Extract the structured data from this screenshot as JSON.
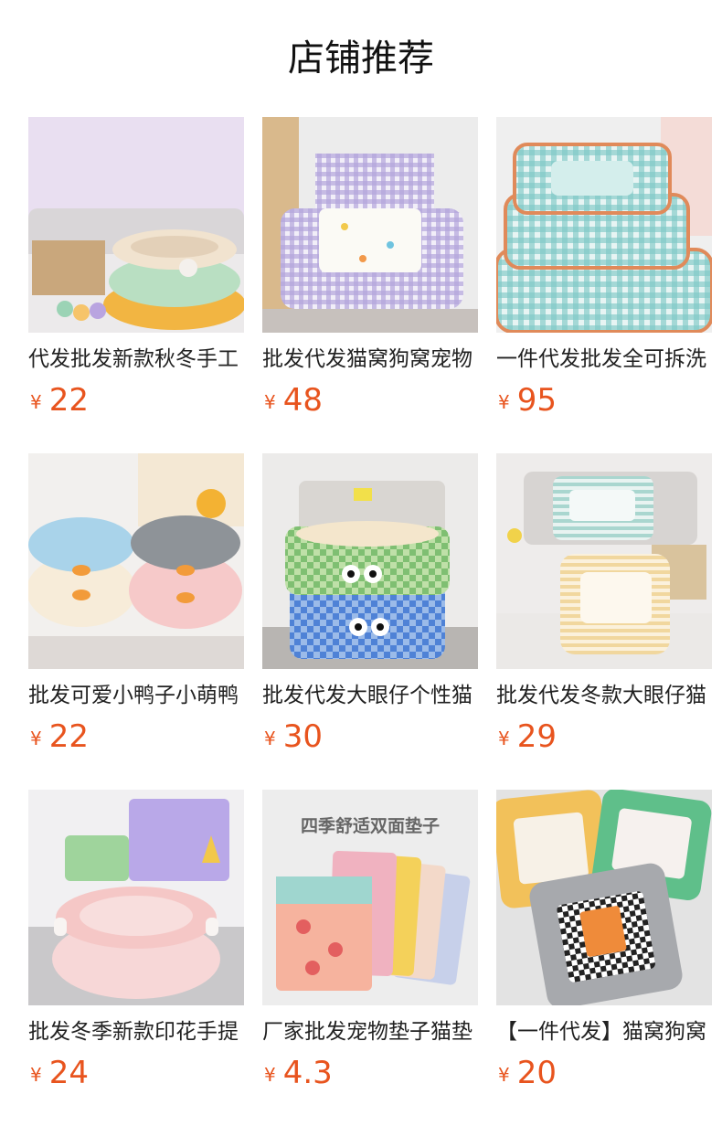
{
  "page": {
    "title": "店铺推荐"
  },
  "theme": {
    "price_color": "#e8541e",
    "text_color": "#222222"
  },
  "products": [
    {
      "name": "代发批发新款秋冬手工",
      "currency": "¥",
      "price": "22",
      "image": "plush-round-pet-beds"
    },
    {
      "name": "批发代发猫窝狗窝宠物",
      "currency": "¥",
      "price": "48",
      "image": "purple-gingham-sofa-bed"
    },
    {
      "name": "一件代发批发全可拆洗",
      "currency": "¥",
      "price": "95",
      "image": "teal-plaid-stacked-beds"
    },
    {
      "name": "批发可爱小鸭子小萌鸭",
      "currency": "¥",
      "price": "22",
      "image": "duck-face-round-beds"
    },
    {
      "name": "批发代发大眼仔个性猫",
      "currency": "¥",
      "price": "30",
      "image": "checkered-googly-eye-baskets"
    },
    {
      "name": "批发代发冬款大眼仔猫",
      "currency": "¥",
      "price": "29",
      "image": "striped-square-beds"
    },
    {
      "name": "批发冬季新款印花手提",
      "currency": "¥",
      "price": "24",
      "image": "pink-round-bed-with-handles"
    },
    {
      "name": "厂家批发宠物垫子猫垫",
      "currency": "¥",
      "price": "4.3",
      "image": "stacked-pet-mats",
      "image_caption": "四季舒适双面垫子"
    },
    {
      "name": "【一件代发】猫窝狗窝",
      "currency": "¥",
      "price": "20",
      "image": "square-colorful-beds"
    }
  ]
}
